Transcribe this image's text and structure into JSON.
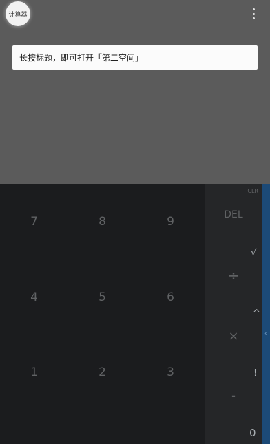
{
  "title": "计算器",
  "hint": "长按标题，即可打开「第二空间」",
  "keys": {
    "digits": [
      {
        "label": "7",
        "name": "key-7"
      },
      {
        "label": "8",
        "name": "key-8"
      },
      {
        "label": "9",
        "name": "key-9"
      },
      {
        "label": "4",
        "name": "key-4"
      },
      {
        "label": "5",
        "name": "key-5"
      },
      {
        "label": "6",
        "name": "key-6"
      },
      {
        "label": "1",
        "name": "key-1"
      },
      {
        "label": "2",
        "name": "key-2"
      },
      {
        "label": "3",
        "name": "key-3"
      }
    ],
    "clr": "CLR",
    "del": "DEL",
    "divide": "÷",
    "multiply": "×",
    "minus": "-"
  },
  "advanced": {
    "sqrt": "√",
    "power": "^",
    "factorial": "!",
    "zero_partial": "0"
  },
  "icons": {
    "overflow": "more-vert-icon",
    "side_chevron": "chevron-left-icon"
  },
  "colors": {
    "top_bg": "#5b5b5b",
    "pad_bg": "#1b1c1e",
    "ops_bg": "#252628",
    "side_bg": "#1c4a77"
  }
}
